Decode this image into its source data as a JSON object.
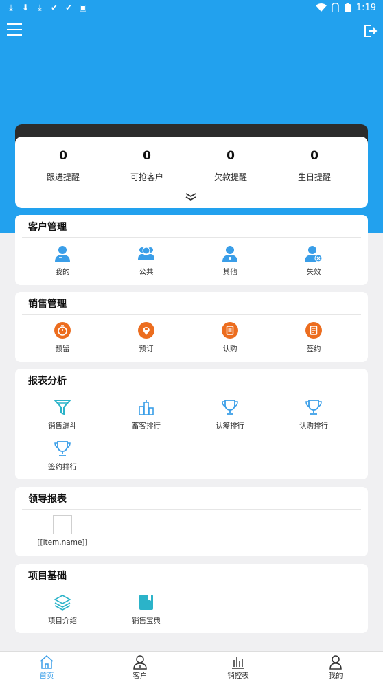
{
  "statusbar": {
    "time": "1:19"
  },
  "stats": [
    {
      "value": "0",
      "label": "跟进提醒"
    },
    {
      "value": "0",
      "label": "可抢客户"
    },
    {
      "value": "0",
      "label": "欠款提醒"
    },
    {
      "value": "0",
      "label": "生日提醒"
    }
  ],
  "customer": {
    "title": "客户管理",
    "items": [
      "我的",
      "公共",
      "其他",
      "失效"
    ]
  },
  "sales": {
    "title": "销售管理",
    "items": [
      "预留",
      "预订",
      "认购",
      "签约"
    ]
  },
  "reports": {
    "title": "报表分析",
    "items": [
      "销售漏斗",
      "蓄客排行",
      "认筹排行",
      "认购排行",
      "签约排行"
    ]
  },
  "leader": {
    "title": "领导报表",
    "items": [
      "[[item.name]]"
    ]
  },
  "project": {
    "title": "项目基础",
    "items": [
      "项目介绍",
      "销售宝典"
    ]
  },
  "nav": [
    {
      "label": "首页"
    },
    {
      "label": "客户"
    },
    {
      "label": "销控表"
    },
    {
      "label": "我的"
    }
  ],
  "colors": {
    "header_blue": "#22a1ee",
    "icon_blue": "#3a9ee8",
    "icon_orange": "#ec6d1f",
    "icon_teal": "#2bb3c9"
  }
}
